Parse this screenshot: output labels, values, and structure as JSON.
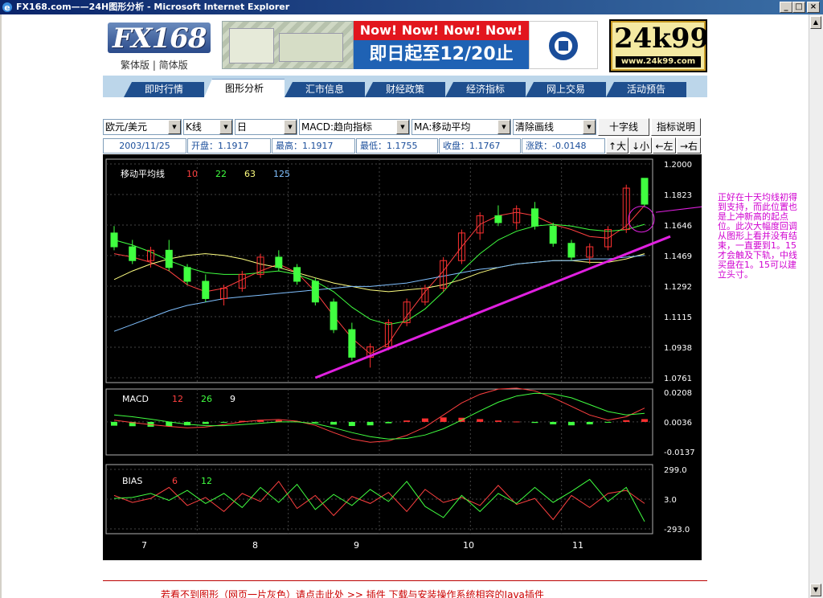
{
  "window": {
    "title": "FX168.com——24H图形分析 - Microsoft Internet Explorer",
    "min_label": "_",
    "max_label": "□",
    "close_label": "×"
  },
  "header": {
    "logo_text": "FX168",
    "lang_links": "繁体版 | 简体版",
    "banner_red": "Now!  Now!  Now!  Now!",
    "banner_blue": "即日起至12/20止",
    "k99_big": "24k99",
    "k99_url": "www.24k99.com"
  },
  "nav": {
    "tabs": [
      "即时行情",
      "图形分析",
      "汇市信息",
      "财经政策",
      "经济指标",
      "网上交易",
      "活动预告"
    ],
    "active": 1
  },
  "toolbar": {
    "pair": "欧元/美元",
    "chart_type": "K线",
    "period": "日",
    "indicator": "MACD:趋向指标",
    "ma": "MA:移动平均",
    "clear": "清除画线",
    "crosshair_btn": "十字线",
    "help_btn": "指标说明"
  },
  "quote": {
    "date": "2003/11/25",
    "open": "开盘：1.1917",
    "high": "最高：1.1917",
    "low": "最低：1.1755",
    "close": "收盘：1.1767",
    "change": "涨跌：-0.0148",
    "zoom_in": "↑大",
    "zoom_out": "↓小",
    "left": "←左",
    "right": "→右"
  },
  "annotation": "正好在十天均线初得到支持，而此位置也是上冲新高的起点位。此次大幅度回调从图形上看并没有结束，一直要到1。15才会触及下轨，中线买盘在1。15可以建立头寸。",
  "footer_text": "若看不到图形（网页一片灰色）请点击此处 >> 插件 下载与安装操作系统相容的Java插件",
  "colors": {
    "up": "#ff3030",
    "down": "#40ff40",
    "ma10": "#ff4040",
    "ma22": "#40ff40",
    "ma63": "#ffff80",
    "ma125": "#80c0ff",
    "trend": "#e020e0"
  },
  "chart_data": [
    {
      "type": "line",
      "title": "移动平均线",
      "series": [
        {
          "name": "10",
          "values": [
            1.148,
            1.146,
            1.143,
            1.138,
            1.13,
            1.126,
            1.128,
            1.133,
            1.138,
            1.142,
            1.137,
            1.126,
            1.112,
            1.099,
            1.09,
            1.096,
            1.112,
            1.126,
            1.138,
            1.152,
            1.165,
            1.17,
            1.172,
            1.17,
            1.165,
            1.162,
            1.158,
            1.157,
            1.164,
            1.176
          ]
        },
        {
          "name": "22",
          "values": [
            1.156,
            1.153,
            1.149,
            1.144,
            1.14,
            1.137,
            1.136,
            1.136,
            1.137,
            1.138,
            1.136,
            1.132,
            1.126,
            1.117,
            1.11,
            1.107,
            1.109,
            1.116,
            1.126,
            1.138,
            1.148,
            1.156,
            1.161,
            1.164,
            1.165,
            1.164,
            1.162,
            1.161,
            1.162,
            1.165
          ]
        },
        {
          "name": "63",
          "values": [
            1.133,
            1.138,
            1.142,
            1.145,
            1.147,
            1.148,
            1.147,
            1.145,
            1.142,
            1.14,
            1.137,
            1.134,
            1.131,
            1.129,
            1.127,
            1.126,
            1.127,
            1.128,
            1.13,
            1.133,
            1.137,
            1.14,
            1.142,
            1.143,
            1.144,
            1.144,
            1.143,
            1.143,
            1.145,
            1.148
          ]
        },
        {
          "name": "125",
          "values": [
            1.103,
            1.107,
            1.111,
            1.115,
            1.118,
            1.12,
            1.122,
            1.123,
            1.124,
            1.125,
            1.126,
            1.127,
            1.128,
            1.129,
            1.129,
            1.13,
            1.131,
            1.133,
            1.135,
            1.137,
            1.139,
            1.14,
            1.142,
            1.143,
            1.144,
            1.144,
            1.145,
            1.145,
            1.146,
            1.147
          ]
        }
      ],
      "candles": [
        [
          1.16,
          1.164,
          1.15,
          1.152
        ],
        [
          1.152,
          1.156,
          1.142,
          1.144
        ],
        [
          1.144,
          1.152,
          1.14,
          1.15
        ],
        [
          1.15,
          1.156,
          1.138,
          1.14
        ],
        [
          1.14,
          1.142,
          1.13,
          1.132
        ],
        [
          1.132,
          1.136,
          1.12,
          1.122
        ],
        [
          1.122,
          1.13,
          1.118,
          1.128
        ],
        [
          1.128,
          1.138,
          1.126,
          1.136
        ],
        [
          1.136,
          1.148,
          1.134,
          1.146
        ],
        [
          1.146,
          1.15,
          1.138,
          1.14
        ],
        [
          1.14,
          1.142,
          1.13,
          1.132
        ],
        [
          1.132,
          1.134,
          1.118,
          1.12
        ],
        [
          1.12,
          1.122,
          1.102,
          1.104
        ],
        [
          1.104,
          1.108,
          1.086,
          1.088
        ],
        [
          1.088,
          1.096,
          1.082,
          1.094
        ],
        [
          1.094,
          1.11,
          1.092,
          1.108
        ],
        [
          1.108,
          1.122,
          1.106,
          1.12
        ],
        [
          1.12,
          1.13,
          1.118,
          1.128
        ],
        [
          1.128,
          1.146,
          1.126,
          1.144
        ],
        [
          1.144,
          1.162,
          1.142,
          1.16
        ],
        [
          1.16,
          1.172,
          1.156,
          1.17
        ],
        [
          1.17,
          1.176,
          1.164,
          1.166
        ],
        [
          1.166,
          1.176,
          1.162,
          1.174
        ],
        [
          1.174,
          1.178,
          1.162,
          1.164
        ],
        [
          1.164,
          1.166,
          1.152,
          1.154
        ],
        [
          1.154,
          1.156,
          1.144,
          1.146
        ],
        [
          1.146,
          1.154,
          1.142,
          1.152
        ],
        [
          1.152,
          1.164,
          1.15,
          1.162
        ],
        [
          1.162,
          1.188,
          1.16,
          1.186
        ],
        [
          1.1917,
          1.1917,
          1.1755,
          1.1767
        ]
      ],
      "xlabels": [
        "7",
        "8",
        "9",
        "10",
        "11"
      ],
      "ylabels": [
        "1.2000",
        "1.1823",
        "1.1646",
        "1.1469",
        "1.1292",
        "1.1115",
        "1.0938",
        "1.0761"
      ],
      "ylim": [
        1.0761,
        1.2
      ]
    },
    {
      "type": "bar",
      "title": "MACD",
      "params": [
        "12",
        "26",
        "9"
      ],
      "ylabels": [
        "0.0208",
        "0.0036",
        "-0.0137"
      ],
      "ylim": [
        -0.0137,
        0.0208
      ],
      "histogram": [
        -0.0022,
        -0.0025,
        -0.0028,
        -0.0026,
        -0.002,
        -0.0012,
        -0.0004,
        0.0006,
        0.0012,
        0.001,
        0.0004,
        -0.0006,
        -0.0016,
        -0.0024,
        -0.002,
        -0.0008,
        0.0008,
        0.002,
        0.0026,
        0.0024,
        0.0016,
        0.0008,
        0.0002,
        -0.0006,
        -0.0014,
        -0.002,
        -0.0014,
        -0.0002,
        0.001,
        0.0016
      ],
      "dif": [
        0.001,
        -0.0004,
        -0.0016,
        -0.0026,
        -0.0034,
        -0.003,
        -0.0016,
        0.0,
        0.001,
        0.0014,
        0.0004,
        -0.002,
        -0.0062,
        -0.01,
        -0.0118,
        -0.011,
        -0.0078,
        -0.003,
        0.004,
        0.011,
        0.016,
        0.019,
        0.0196,
        0.018,
        0.014,
        0.009,
        0.004,
        0.001,
        0.003,
        0.008
      ],
      "dea": [
        0.004,
        0.003,
        0.0016,
        0.0,
        -0.0014,
        -0.0022,
        -0.0022,
        -0.0016,
        -0.0008,
        0.0,
        0.0,
        -0.001,
        -0.0034,
        -0.0062,
        -0.0086,
        -0.01,
        -0.0096,
        -0.0076,
        -0.004,
        0.001,
        0.0064,
        0.0114,
        0.015,
        0.0166,
        0.0162,
        0.014,
        0.01,
        0.006,
        0.004,
        0.005
      ]
    },
    {
      "type": "line",
      "title": "BIAS",
      "params": [
        "6",
        "12"
      ],
      "ylabels": [
        "299.0",
        "3.0",
        "-293.0"
      ],
      "ylim": [
        -293,
        299
      ],
      "series": [
        {
          "name": "6",
          "values": [
            40,
            -30,
            10,
            120,
            -60,
            20,
            -120,
            60,
            -20,
            180,
            -90,
            40,
            -160,
            30,
            -40,
            70,
            -120,
            100,
            -30,
            20,
            -60,
            140,
            -50,
            10,
            -200,
            40,
            -80,
            60,
            90,
            -40
          ]
        },
        {
          "name": "12",
          "values": [
            10,
            20,
            60,
            -10,
            90,
            -40,
            60,
            -80,
            120,
            -30,
            150,
            -100,
            50,
            -60,
            100,
            -20,
            180,
            -70,
            -180,
            40,
            -120,
            60,
            -40,
            120,
            -30,
            80,
            200,
            -20,
            120,
            -220
          ]
        }
      ]
    }
  ]
}
